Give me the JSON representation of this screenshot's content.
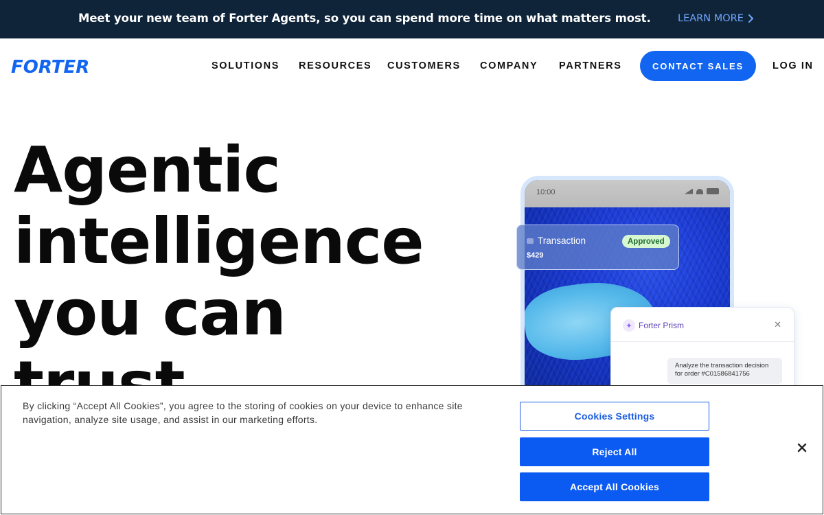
{
  "announcement": {
    "text": "Meet your new team of Forter Agents, so you can spend more time on what matters most.",
    "link_label": "LEARN MORE",
    "link_icon": "chevron-right-icon"
  },
  "brand": {
    "logo_text": "FORTER",
    "accent": "#1265f0",
    "dark": "#0f2439"
  },
  "nav": {
    "items": [
      "SOLUTIONS",
      "RESOURCES",
      "CUSTOMERS",
      "COMPANY",
      "PARTNERS"
    ],
    "contact_label": "CONTACT SALES",
    "login_label": "LOG IN"
  },
  "hero": {
    "lines": [
      "Agentic",
      "intelligence",
      "you can",
      "trust"
    ]
  },
  "phone": {
    "time": "10:00",
    "transaction": {
      "title": "Transaction",
      "amount": "$429",
      "status": "Approved"
    },
    "prism": {
      "name": "Forter Prism",
      "message": "Analyze the transaction decision for order #C01586841756"
    }
  },
  "cookies": {
    "text": "By clicking “Accept All Cookies”, you agree to the storing of cookies on your device to enhance site navigation, analyze site usage, and assist in our marketing efforts.",
    "settings_label": "Cookies Settings",
    "reject_label": "Reject All",
    "accept_label": "Accept All Cookies"
  }
}
